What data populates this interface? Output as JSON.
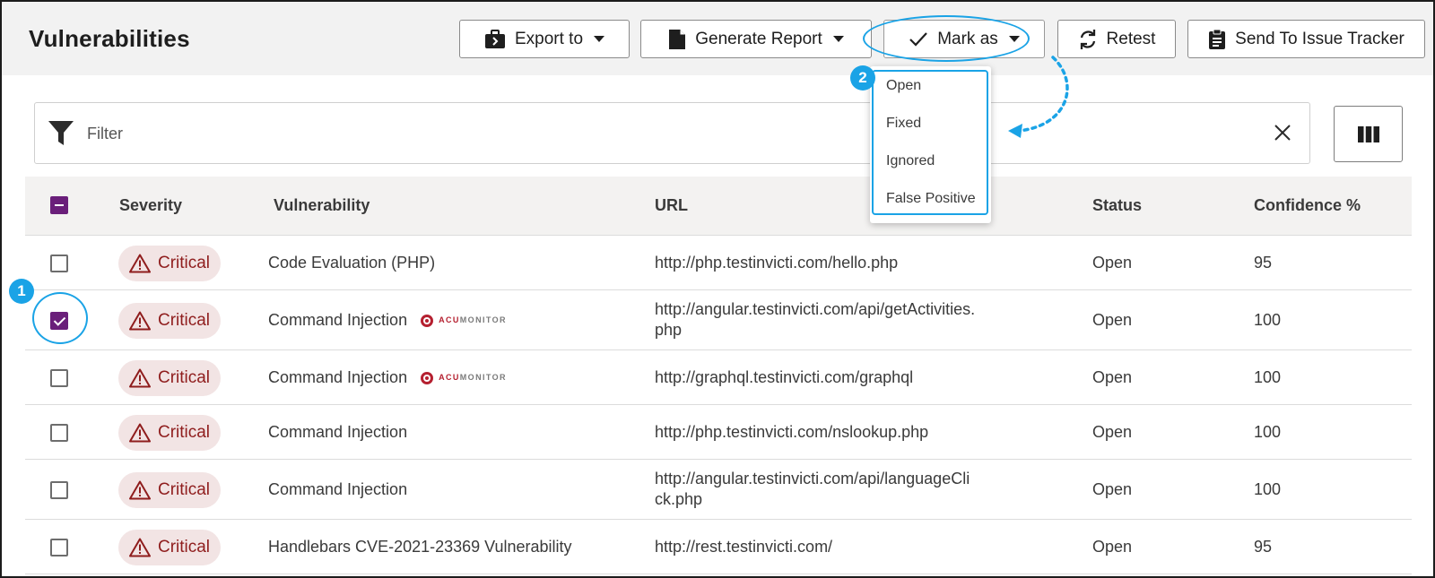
{
  "header": {
    "title": "Vulnerabilities",
    "buttons": {
      "export": "Export to",
      "report": "Generate Report",
      "mark": "Mark as",
      "retest": "Retest",
      "issue": "Send To Issue Tracker"
    }
  },
  "filter": {
    "placeholder": "Filter"
  },
  "mark_menu": {
    "items": [
      "Open",
      "Fixed",
      "Ignored",
      "False Positive"
    ]
  },
  "table": {
    "columns": [
      "Severity",
      "Vulnerability",
      "URL",
      "Status",
      "Confidence %"
    ],
    "rows": [
      {
        "checked": false,
        "severity": "Critical",
        "vulnerability": "Code Evaluation (PHP)",
        "acumonitor": false,
        "url": "http://php.testinvicti.com/hello.php",
        "status": "Open",
        "confidence": "95"
      },
      {
        "checked": true,
        "severity": "Critical",
        "vulnerability": "Command Injection",
        "acumonitor": true,
        "url": "http://angular.testinvicti.com/api/getActivities.php",
        "status": "Open",
        "confidence": "100"
      },
      {
        "checked": false,
        "severity": "Critical",
        "vulnerability": "Command Injection",
        "acumonitor": true,
        "url": "http://graphql.testinvicti.com/graphql",
        "status": "Open",
        "confidence": "100"
      },
      {
        "checked": false,
        "severity": "Critical",
        "vulnerability": "Command Injection",
        "acumonitor": false,
        "url": "http://php.testinvicti.com/nslookup.php",
        "status": "Open",
        "confidence": "100"
      },
      {
        "checked": false,
        "severity": "Critical",
        "vulnerability": "Command Injection",
        "acumonitor": false,
        "url": "http://angular.testinvicti.com/api/languageClick.php",
        "status": "Open",
        "confidence": "100"
      },
      {
        "checked": false,
        "severity": "Critical",
        "vulnerability": "Handlebars CVE-2021-23369 Vulnerability",
        "acumonitor": false,
        "url": "http://rest.testinvicti.com/",
        "status": "Open",
        "confidence": "95"
      }
    ]
  },
  "acumonitor": {
    "prefix": "ACU",
    "suffix": "MONITOR"
  },
  "annotations": {
    "step1": "1",
    "step2": "2"
  },
  "colors": {
    "accent": "#1aa3e6",
    "checkbox": "#6a1f7a",
    "critical": "#8f1d1d",
    "critical_bg": "#f2e4e4"
  }
}
